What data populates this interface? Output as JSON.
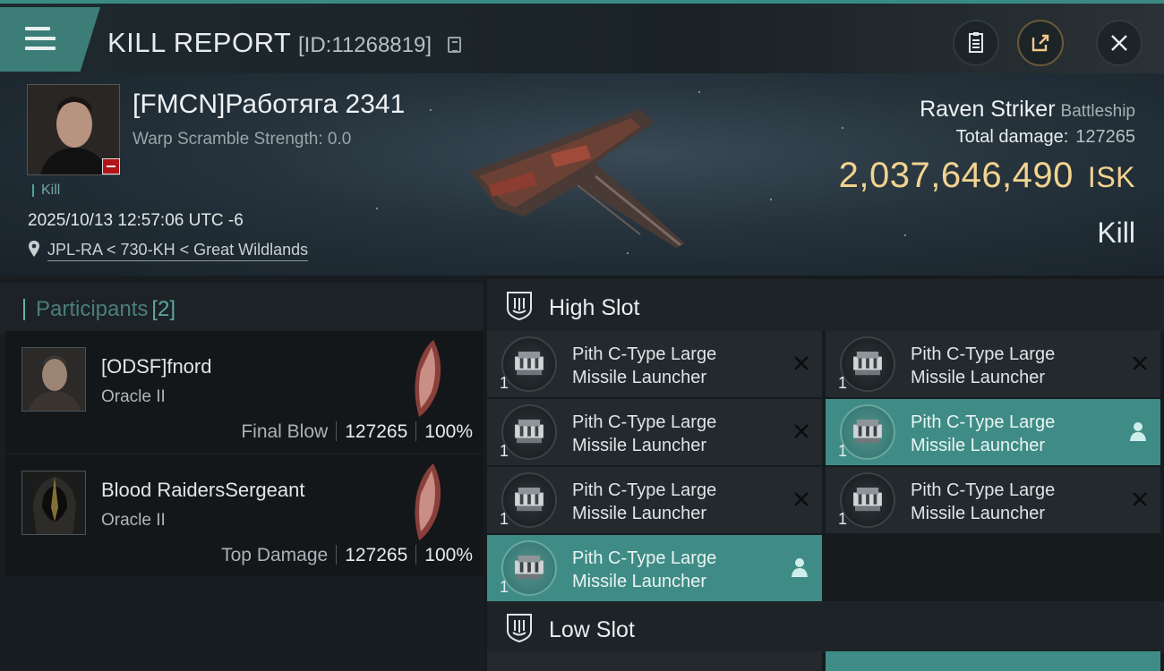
{
  "header": {
    "title": "KILL REPORT",
    "report_id": "[ID:11268819]"
  },
  "victim": {
    "name": "[FMCN]Работяга 2341",
    "warp_scramble": "Warp Scramble Strength: 0.0",
    "kill_tag": "Kill",
    "datetime": "2025/10/13 12:57:06 UTC -6",
    "location": "JPL-RA < 730-KH < Great Wildlands",
    "ship_name": "Raven Striker",
    "ship_class": "Battleship",
    "total_damage_label": "Total damage:",
    "total_damage": "127265",
    "isk_value": "2,037,646,490",
    "isk_unit": "ISK",
    "result": "Kill"
  },
  "participants": {
    "label": "Participants",
    "count": "[2]",
    "rows": [
      {
        "name": "[ODSF]fnord",
        "ship": "Oracle II",
        "role": "Final Blow",
        "damage": "127265",
        "percent": "100%"
      },
      {
        "name": "Blood RaidersSergeant",
        "ship": "Oracle II",
        "role": "Top Damage",
        "damage": "127265",
        "percent": "100%"
      }
    ]
  },
  "fittings": {
    "high_slot_label": "High Slot",
    "low_slot_label": "Low Slot",
    "high_modules": [
      {
        "name": "Pith C-Type Large\nMissile Launcher",
        "qty": "1",
        "state": "destroyed"
      },
      {
        "name": "Pith C-Type Large\nMissile Launcher",
        "qty": "1",
        "state": "destroyed"
      },
      {
        "name": "Pith C-Type Large\nMissile Launcher",
        "qty": "1",
        "state": "destroyed"
      },
      {
        "name": "Pith C-Type Large\nMissile Launcher",
        "qty": "1",
        "state": "dropped"
      },
      {
        "name": "Pith C-Type Large\nMissile Launcher",
        "qty": "1",
        "state": "destroyed"
      },
      {
        "name": "Pith C-Type Large\nMissile Launcher",
        "qty": "1",
        "state": "destroyed"
      },
      {
        "name": "Pith C-Type Large\nMissile Launcher",
        "qty": "1",
        "state": "dropped"
      }
    ]
  },
  "icons": {
    "menu": "hamburger-menu-icon",
    "copy": "copy-icon",
    "clipboard": "clipboard-icon",
    "share": "share-icon",
    "close": "close-icon",
    "location": "location-pin-icon",
    "destroyed": "x-mark-icon",
    "dropped": "pilot-icon"
  },
  "colors": {
    "accent": "#3f8c86",
    "isk": "#f2d38f",
    "badge": "#b1141a"
  }
}
